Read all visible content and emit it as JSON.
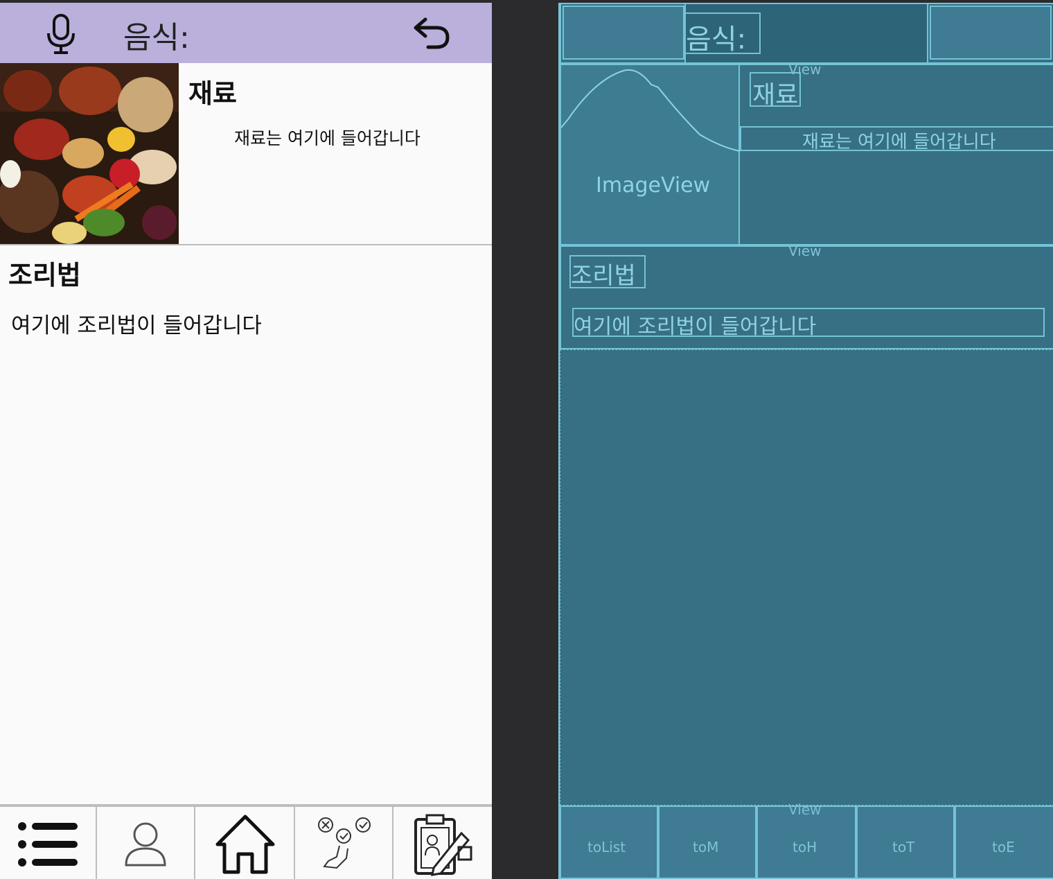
{
  "design": {
    "header": {
      "title": "음식:",
      "mic_icon": "microphone-icon",
      "back_icon": "undo-arrow-icon"
    },
    "ingredients": {
      "title": "재료",
      "text": "재료는 여기에 들어갑니다",
      "image": "food-groceries-photo"
    },
    "recipe": {
      "title": "조리법",
      "text": "여기에 조리법이 들어갑니다"
    },
    "navbar": {
      "items": [
        {
          "icon": "list-icon"
        },
        {
          "icon": "person-icon"
        },
        {
          "icon": "home-icon"
        },
        {
          "icon": "choice-checklist-icon"
        },
        {
          "icon": "clipboard-edit-icon"
        }
      ]
    }
  },
  "blueprint": {
    "header_title": "음식:",
    "view_label": "View",
    "image_view_label": "ImageView",
    "ingredients_title": "재료",
    "ingredients_text": "재료는 여기에 들어갑니다",
    "recipe_title": "조리법",
    "recipe_text": "여기에 조리법이 들어갑니다",
    "nav_labels": [
      "toList",
      "toM",
      "toH",
      "toT",
      "toE"
    ]
  },
  "colors": {
    "header_bg": "#bbb0dc",
    "blueprint_bg": "#376f84",
    "blueprint_line": "#74c4d8",
    "canvas_bg": "#2b2b2d"
  }
}
